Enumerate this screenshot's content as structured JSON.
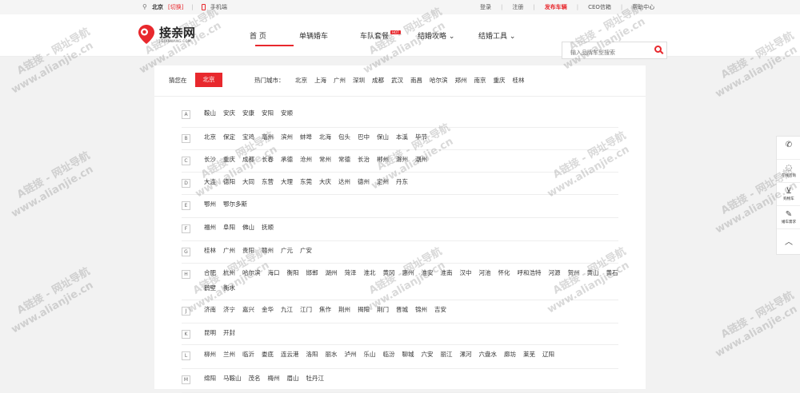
{
  "topbar": {
    "city": "北京",
    "switch": "[切换]",
    "mobile": "手机端",
    "links": [
      "登录",
      "注册",
      "发布车辆",
      "CEO信箱",
      "帮助中心"
    ]
  },
  "logo": {
    "name": "接亲网",
    "sub": "JIEQINWANG.COM"
  },
  "nav": [
    "首 页",
    "单辆婚车",
    "车队套餐",
    "结婚攻略",
    "结婚工具"
  ],
  "nav_hot": "HOT",
  "search": {
    "placeholder": "输入品牌车型搜索"
  },
  "guess": {
    "label": "猜您在",
    "city": "北京"
  },
  "hot": {
    "label": "热门城市：",
    "cities": [
      "北京",
      "上海",
      "广州",
      "深圳",
      "成都",
      "武汉",
      "南昌",
      "哈尔滨",
      "郑州",
      "南京",
      "重庆",
      "桂林"
    ]
  },
  "letters": [
    {
      "letter": "A",
      "cities": [
        "鞍山",
        "安庆",
        "安康",
        "安阳",
        "安顺"
      ]
    },
    {
      "letter": "B",
      "cities": [
        "北京",
        "保定",
        "宝鸡",
        "亳州",
        "滨州",
        "蚌埠",
        "北海",
        "包头",
        "巴中",
        "保山",
        "本溪",
        "毕节"
      ]
    },
    {
      "letter": "C",
      "cities": [
        "长沙",
        "重庆",
        "成都",
        "长春",
        "承德",
        "沧州",
        "常州",
        "常德",
        "长治",
        "郴州",
        "滁州",
        "潮州"
      ]
    },
    {
      "letter": "D",
      "cities": [
        "大连",
        "德阳",
        "大同",
        "东营",
        "大理",
        "东莞",
        "大庆",
        "达州",
        "德州",
        "定州",
        "丹东"
      ]
    },
    {
      "letter": "E",
      "cities": [
        "鄂州",
        "鄂尔多斯"
      ]
    },
    {
      "letter": "F",
      "cities": [
        "福州",
        "阜阳",
        "佛山",
        "抚顺"
      ]
    },
    {
      "letter": "G",
      "cities": [
        "桂林",
        "广州",
        "贵阳",
        "赣州",
        "广元",
        "广安"
      ]
    },
    {
      "letter": "H",
      "cities": [
        "合肥",
        "杭州",
        "哈尔滨",
        "海口",
        "衡阳",
        "邯郸",
        "湖州",
        "菏泽",
        "淮北",
        "黄冈",
        "惠州",
        "淮安",
        "淮南",
        "汉中",
        "河池",
        "怀化",
        "呼和浩特",
        "河源",
        "贺州",
        "黄山",
        "黄石",
        "鹤壁",
        "衡水"
      ]
    },
    {
      "letter": "J",
      "cities": [
        "济南",
        "济宁",
        "嘉兴",
        "金华",
        "九江",
        "江门",
        "焦作",
        "荆州",
        "揭阳",
        "荆门",
        "晋城",
        "锦州",
        "吉安"
      ]
    },
    {
      "letter": "K",
      "cities": [
        "昆明",
        "开封"
      ]
    },
    {
      "letter": "L",
      "cities": [
        "柳州",
        "兰州",
        "临沂",
        "娄底",
        "连云港",
        "洛阳",
        "丽水",
        "泸州",
        "乐山",
        "临汾",
        "聊城",
        "六安",
        "丽江",
        "漯河",
        "六盘水",
        "廊坊",
        "莱芜",
        "辽阳"
      ]
    },
    {
      "letter": "M",
      "cities": [
        "绵阳",
        "马鞍山",
        "茂名",
        "梅州",
        "眉山",
        "牡丹江"
      ]
    }
  ],
  "sidebar": [
    "",
    "在线咨询",
    "购物车",
    "婚车需求",
    ""
  ],
  "watermark": {
    "line1": "A链接 - 网址导航",
    "line2": "www.alianjie.cn"
  }
}
